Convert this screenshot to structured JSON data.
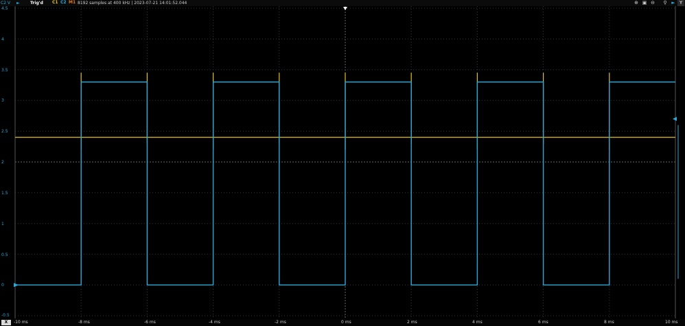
{
  "topbar": {
    "y_scale_label": "C2 V",
    "run_icon": "play-icon",
    "trig_status": "Trig'd",
    "channels": [
      {
        "label": "C1",
        "color": "#e6c21a"
      },
      {
        "label": "C2",
        "color": "#2aa9d8"
      },
      {
        "label": "M1",
        "color": "#e07a2a"
      }
    ],
    "acq_info": "8192 samples at 400 kHz | 2023-07-21 14:01:52.044",
    "right_icons": [
      "zoom-in-icon",
      "zoom-fit-icon",
      "zoom-out-icon",
      "cursor-icon"
    ],
    "right_axis_letter": "Y"
  },
  "bottombar": {
    "axis_button": "X",
    "x_ticks": [
      "-10 ms",
      "-8 ms",
      "-6 ms",
      "-4 ms",
      "-2 ms",
      "0 ms",
      "2 ms",
      "4 ms",
      "6 ms",
      "8 ms",
      "10 ms"
    ]
  },
  "y_ticks": [
    "4.5",
    "4",
    "3.5",
    "3",
    "2.5",
    "2",
    "1.5",
    "1",
    "0.5",
    "0",
    "-0.5"
  ],
  "chart_data": {
    "type": "line",
    "x_unit": "ms",
    "y_unit": "V",
    "xlim": [
      -10,
      10
    ],
    "ylim": [
      -0.5,
      4.5
    ],
    "grid": true,
    "series": [
      {
        "name": "C1",
        "color": "#e6c21a",
        "x": [
          -10,
          10
        ],
        "y": [
          2.4,
          2.4
        ],
        "note_spikes_at_ms": [
          -8,
          -4,
          0,
          4,
          8
        ]
      },
      {
        "name": "C2",
        "color": "#2aa9d8",
        "x": [
          -10,
          -8,
          -8,
          -6,
          -6,
          -4,
          -4,
          -2,
          -2,
          0,
          0,
          2,
          2,
          4,
          4,
          6,
          6,
          8,
          8,
          10
        ],
        "y": [
          0,
          0,
          3.3,
          3.3,
          0,
          0,
          3.3,
          3.3,
          0,
          0,
          3.3,
          3.3,
          0,
          0,
          3.3,
          3.3,
          0,
          0,
          3.3,
          3.3
        ]
      }
    ]
  }
}
